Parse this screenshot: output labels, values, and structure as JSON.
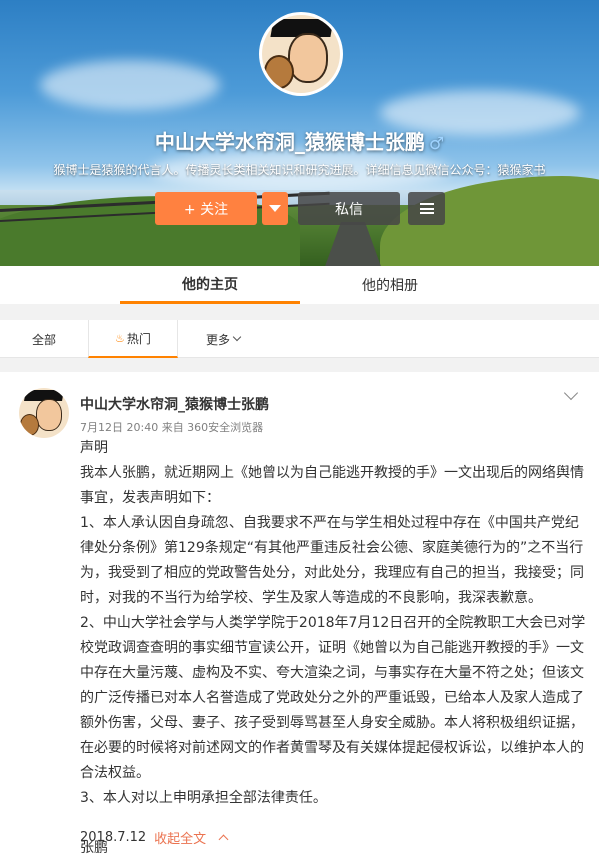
{
  "profile": {
    "name": "中山大学水帘洞_猿猴博士张鹏",
    "gender_symbol": "♂",
    "description": "猴博士是猿猴的代言人。传播灵长类相关知识和研究进展。详细信息见微信公众号：猿猴家书",
    "follow_label": "+ 关注",
    "message_label": "私信"
  },
  "nav": {
    "home": "他的主页",
    "album": "他的相册"
  },
  "tabs": {
    "all": "全部",
    "hot": "热门",
    "more": "更多"
  },
  "post": {
    "author": "中山大学水帘洞_猿猴博士张鹏",
    "meta": "7月12日 20:40 来自 360安全浏览器",
    "lines": [
      "声明",
      "我本人张鹏，就近期网上《她曾以为自己能逃开教授的手》一文出现后的网络舆情事宜，发表声明如下：",
      "1、本人承认因自身疏忽、自我要求不严在与学生相处过程中存在《中国共产党纪律处分条例》第129条规定“有其他严重违反社会公德、家庭美德行为的”之不当行为，我受到了相应的党政警告处分，对此处分，我理应有自己的担当，我接受；同时，对我的不当行为给学校、学生及家人等造成的不良影响，我深表歉意。",
      "2、中山大学社会学与人类学学院于2018年7月12日召开的全院教职工大会已对学校党政调查查明的事实细节宣读公开，证明《她曾以为自己能逃开教授的手》一文中存在大量污蔑、虚构及不实、夸大渲染之词，与事实存在大量不符之处；但该文的广泛传播已对本人名誉造成了党政处分之外的严重诋毁，已给本人及家人造成了额外伤害，父母、妻子、孩子受到辱骂甚至人身安全威胁。本人将积极组织证据，在必要的时候将对前述网文的作者黄雪琴及有关媒体提起侵权诉讼，以维护本人的合法权益。",
      "3、本人对以上申明承担全部法律责任。",
      "",
      "张鹏"
    ],
    "date": "2018.7.12",
    "collapse_label": "收起全文"
  },
  "colors": {
    "accent": "#ff8200",
    "follow": "#ff8140",
    "link": "#eb7350"
  }
}
